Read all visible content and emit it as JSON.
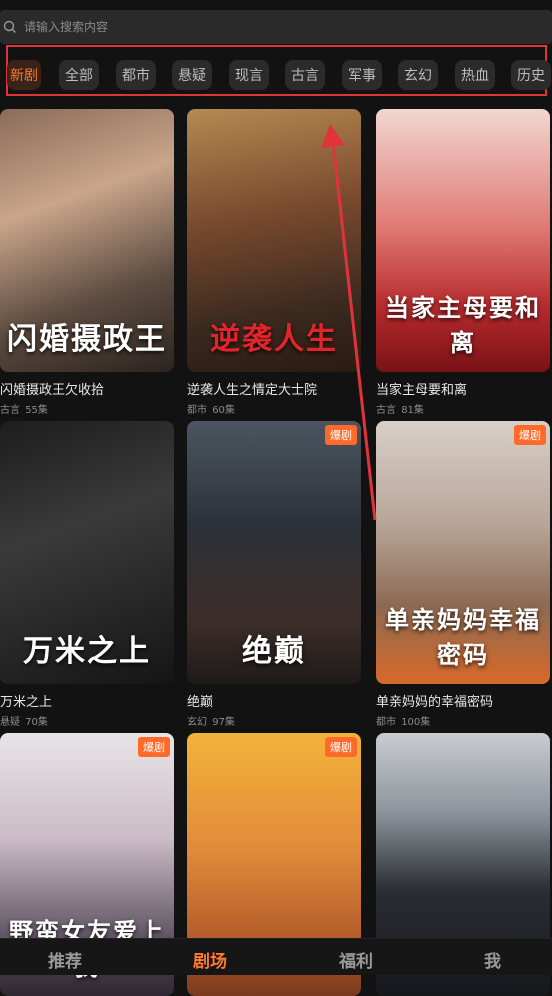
{
  "search": {
    "placeholder": "请输入搜索内容"
  },
  "categories": [
    "新剧",
    "全部",
    "都市",
    "悬疑",
    "现言",
    "古言",
    "军事",
    "玄幻",
    "热血",
    "历史"
  ],
  "active_category": "新剧",
  "colors": {
    "accent": "#ff7a2e",
    "highlight_box": "#e0343a",
    "hot_badge": "#ff6a2a"
  },
  "hot_badge_label": "爆剧",
  "cards": [
    {
      "title": "闪婚摄政王欠收拾",
      "genre": "古言",
      "episodes": "55集",
      "overlay": "闪婚摄政王",
      "hot": false
    },
    {
      "title": "逆袭人生之情定大士院",
      "genre": "都市",
      "episodes": "60集",
      "overlay": "逆袭人生",
      "hot": false
    },
    {
      "title": "当家主母要和离",
      "genre": "古言",
      "episodes": "81集",
      "overlay": "当家主母要和离",
      "hot": false
    },
    {
      "title": "万米之上",
      "genre": "悬疑",
      "episodes": "70集",
      "overlay": "万米之上",
      "hot": false
    },
    {
      "title": "绝巅",
      "genre": "玄幻",
      "episodes": "97集",
      "overlay": "绝巅",
      "hot": true
    },
    {
      "title": "单亲妈妈的幸福密码",
      "genre": "都市",
      "episodes": "100集",
      "overlay": "单亲妈妈幸福密码",
      "hot": true
    },
    {
      "title": "",
      "genre": "",
      "episodes": "",
      "overlay": "野蛮女友爱上我",
      "hot": true
    },
    {
      "title": "",
      "genre": "",
      "episodes": "",
      "overlay": "",
      "hot": true
    },
    {
      "title": "",
      "genre": "",
      "episodes": "",
      "overlay": "",
      "hot": false
    }
  ],
  "tabs": [
    "推荐",
    "剧场",
    "福利",
    "我"
  ],
  "active_tab": "剧场"
}
